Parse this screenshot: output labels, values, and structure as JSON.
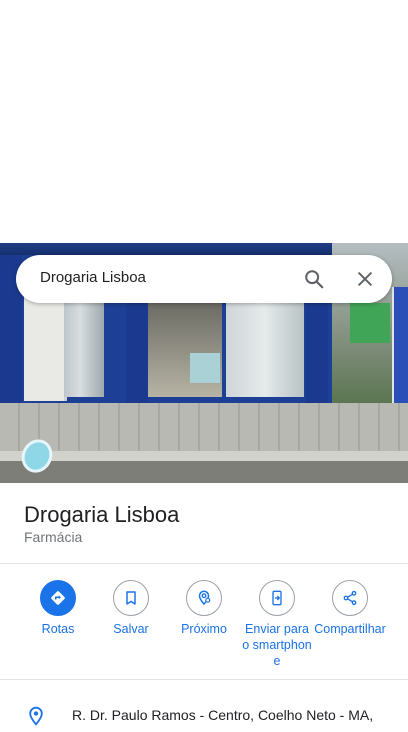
{
  "search": {
    "query": "Drogaria Lisboa",
    "search_icon": "search-icon",
    "close_icon": "close-icon"
  },
  "place": {
    "name": "Drogaria Lisboa",
    "category": "Farmácia",
    "address": "R. Dr. Paulo Ramos - Centro, Coelho Neto - MA,"
  },
  "actions": [
    {
      "label": "Rotas",
      "icon": "directions-icon"
    },
    {
      "label": "Salvar",
      "icon": "bookmark-icon"
    },
    {
      "label": "Próximo",
      "icon": "nearby-icon"
    },
    {
      "label": "Enviar para o smartphone",
      "icon": "send-to-phone-icon"
    },
    {
      "label": "Compartilhar",
      "icon": "share-icon"
    }
  ],
  "colors": {
    "accent": "#1a73e8",
    "text_primary": "#202124",
    "text_secondary": "#70757a"
  }
}
